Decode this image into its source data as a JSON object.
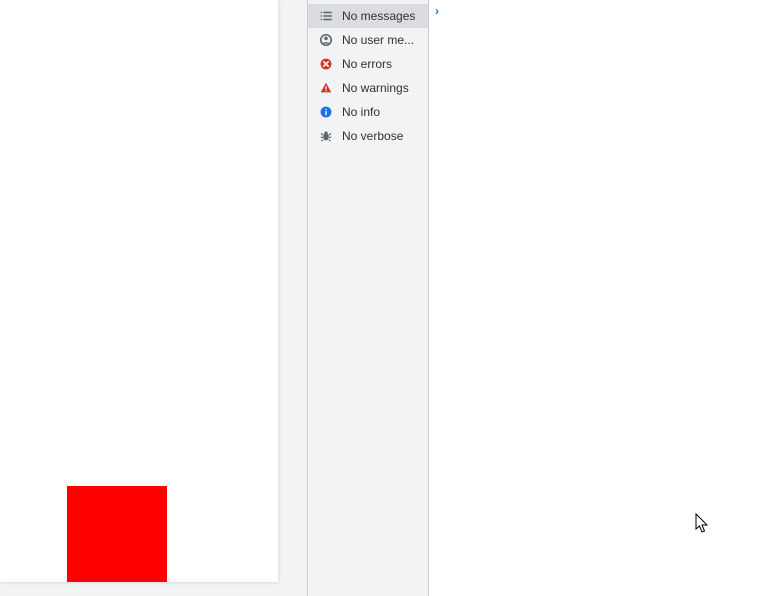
{
  "sidebar": {
    "items": [
      {
        "label": "No messages"
      },
      {
        "label": "No user me..."
      },
      {
        "label": "No errors"
      },
      {
        "label": "No warnings"
      },
      {
        "label": "No info"
      },
      {
        "label": "No verbose"
      }
    ]
  },
  "console": {
    "prompt": "›"
  }
}
